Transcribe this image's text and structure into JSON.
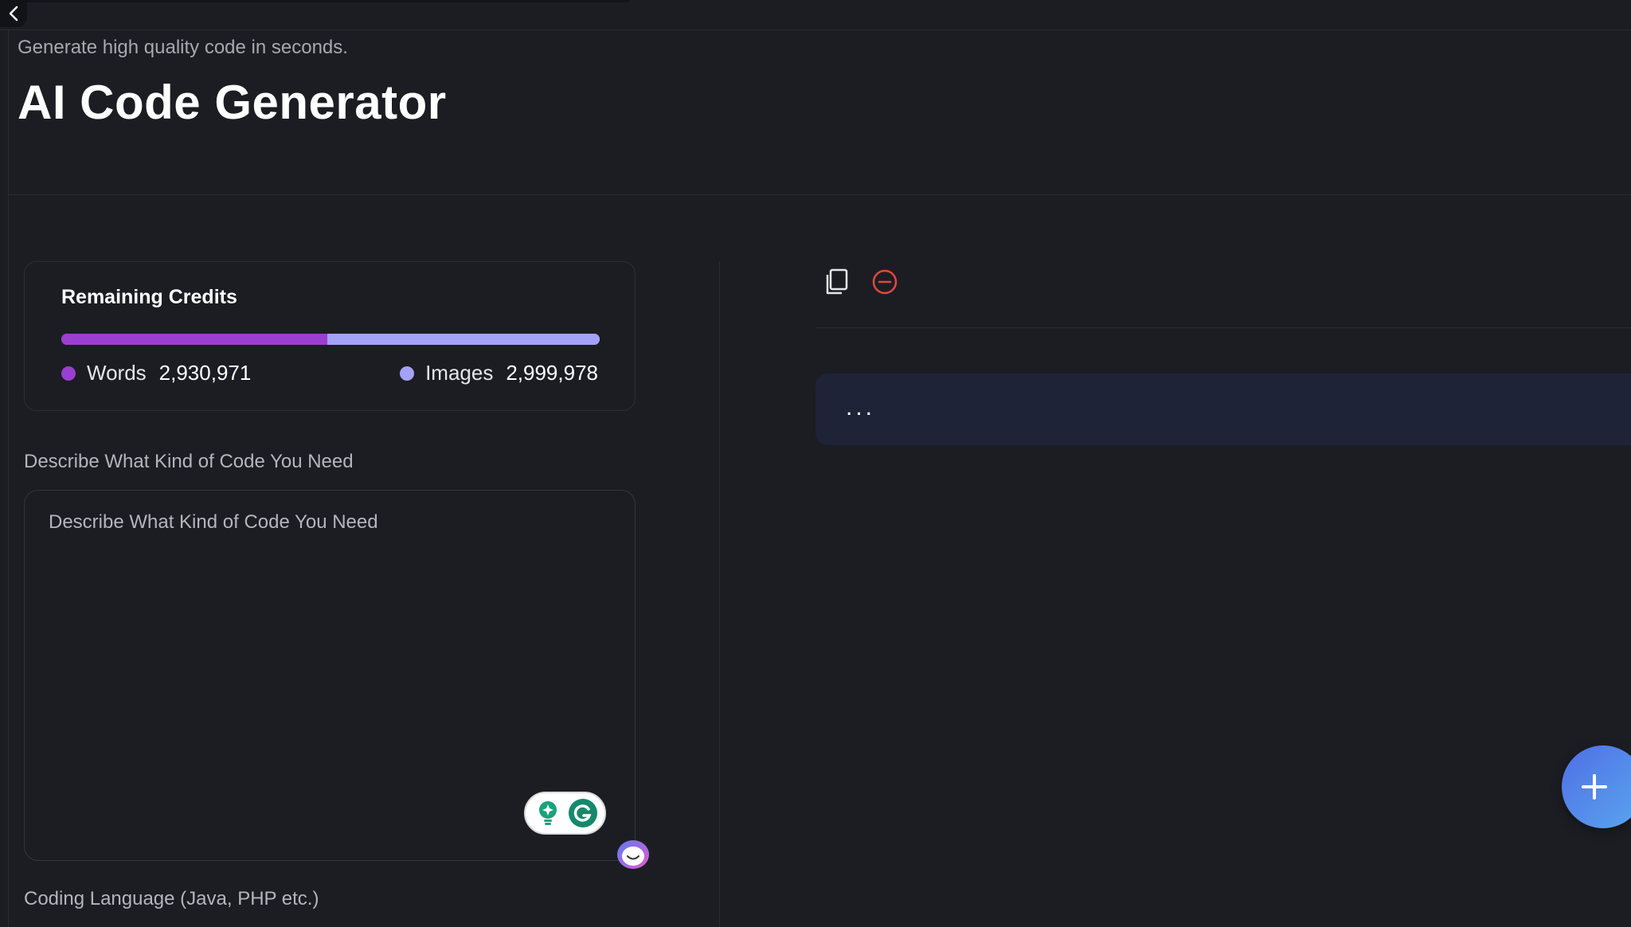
{
  "header": {
    "subtitle": "Generate high quality code in seconds.",
    "title": "AI Code Generator"
  },
  "credits": {
    "title": "Remaining Credits",
    "words_label": "Words",
    "words_value": "2,930,971",
    "images_label": "Images",
    "images_value": "2,999,978",
    "words_share": 0.494,
    "colors": {
      "words": "#9a3fcf",
      "images": "#a3a2f7"
    }
  },
  "form": {
    "description_label": "Describe What Kind of Code You Need",
    "description_placeholder": "Describe What Kind of Code You Need",
    "description_value": "",
    "language_label": "Coding Language (Java, PHP etc.)"
  },
  "output": {
    "content": "...",
    "icons": [
      "copy-icon",
      "delete-icon"
    ]
  },
  "colors": {
    "background": "#1c1d23",
    "output_bg": "#1f2338",
    "delete_icon": "#e0483f",
    "fab_gradient_start": "#4f6fe6",
    "fab_gradient_end": "#5aa6ee"
  }
}
